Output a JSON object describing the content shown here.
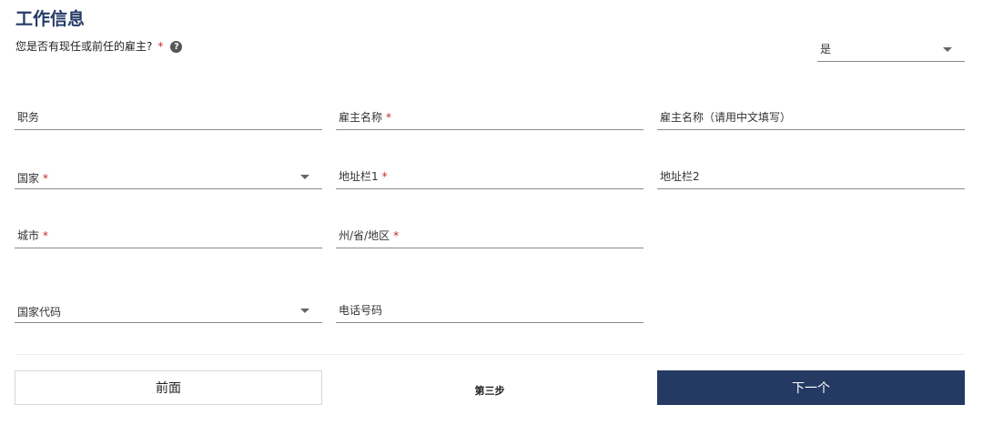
{
  "section": {
    "title": "工作信息"
  },
  "employer_question": {
    "label": "您是否有现任或前任的雇主?",
    "required_mark": "*",
    "help_glyph": "?",
    "selected_value": "是"
  },
  "fields": {
    "job_title": {
      "label": "职务"
    },
    "employer_name": {
      "label": "雇主名称",
      "required_mark": "*"
    },
    "employer_name_cn": {
      "label": "雇主名称（请用中文填写）"
    },
    "country": {
      "label": "国家",
      "required_mark": "*"
    },
    "address_line1": {
      "label": "地址栏1",
      "required_mark": "*"
    },
    "address_line2": {
      "label": "地址栏2"
    },
    "city": {
      "label": "城市",
      "required_mark": "*"
    },
    "state_province": {
      "label": "州/省/地区",
      "required_mark": "*"
    },
    "country_code": {
      "label": "国家代码"
    },
    "phone_number": {
      "label": "电话号码"
    }
  },
  "footer": {
    "prev_label": "前面",
    "step_label": "第三步",
    "next_label": "下一个"
  },
  "colors": {
    "title": "#243a66",
    "primary_button": "#243a63",
    "required": "#c62828",
    "underline": "#8a8a8a"
  }
}
